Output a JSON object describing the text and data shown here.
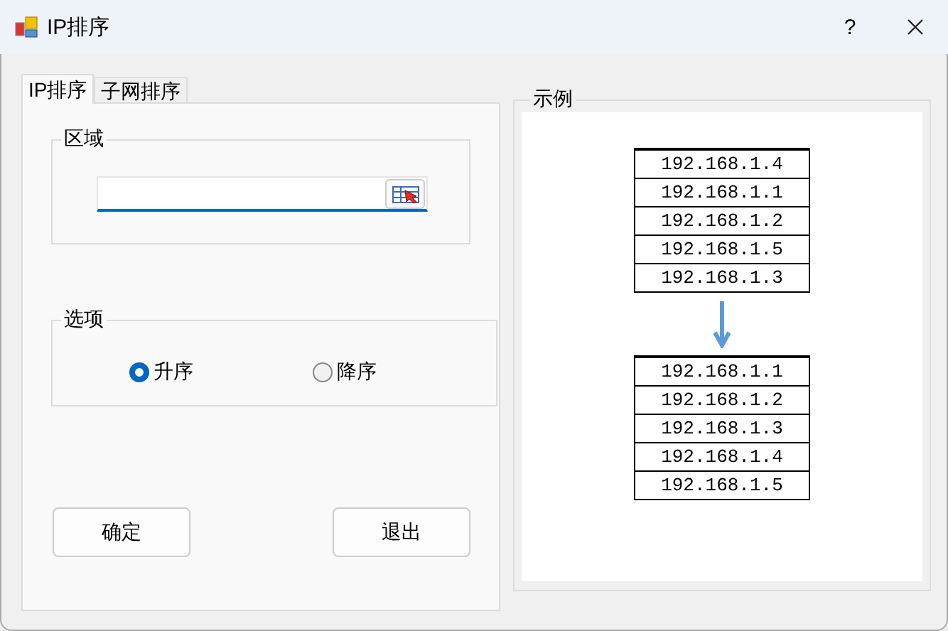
{
  "window": {
    "title": "IP排序",
    "help": "?"
  },
  "tabs": [
    {
      "label": "IP排序",
      "selected": true
    },
    {
      "label": "子网排序",
      "selected": false
    }
  ],
  "region": {
    "title": "区域"
  },
  "options": {
    "title": "选项",
    "radios": [
      {
        "label": "升序",
        "selected": true
      },
      {
        "label": "降序",
        "selected": false
      }
    ]
  },
  "buttons": [
    "确定",
    "退出"
  ],
  "example": {
    "title": "示例",
    "before": [
      "192.168.1.4",
      "192.168.1.1",
      "192.168.1.2",
      "192.168.1.5",
      "192.168.1.3"
    ],
    "after": [
      "192.168.1.1",
      "192.168.1.2",
      "192.168.1.3",
      "192.168.1.4",
      "192.168.1.5"
    ]
  }
}
